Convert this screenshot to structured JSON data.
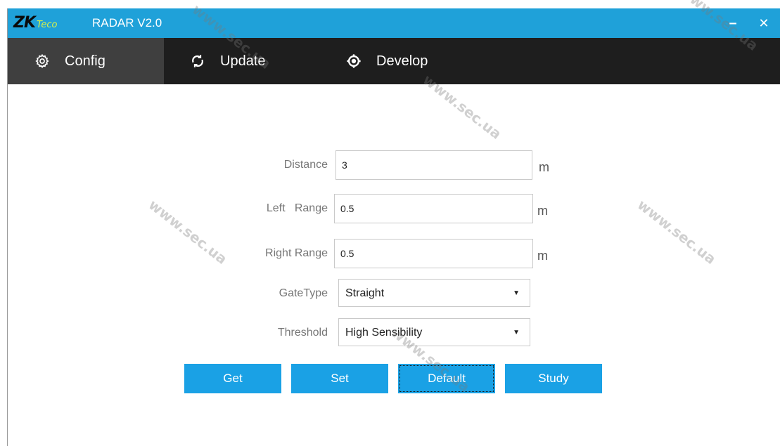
{
  "app": {
    "logo_zk": "ZK",
    "logo_teco": "Teco",
    "title": "RADAR V2.0",
    "minimize_glyph": "–",
    "close_glyph": "✕"
  },
  "nav": {
    "items": [
      {
        "label": "Config",
        "icon": "gear-icon",
        "active": true
      },
      {
        "label": "Update",
        "icon": "refresh-icon",
        "active": false
      },
      {
        "label": "Develop",
        "icon": "develop-icon",
        "active": false
      }
    ]
  },
  "form": {
    "distance": {
      "label": "Distance",
      "value": "3",
      "unit": "m"
    },
    "left_range": {
      "label": "Left   Range",
      "value": "0.5",
      "unit": "m"
    },
    "right_range": {
      "label": "Right Range",
      "value": "0.5",
      "unit": "m"
    },
    "gate_type": {
      "label": "GateType",
      "selected": "Straight"
    },
    "threshold": {
      "label": "Threshold",
      "selected": "High Sensibility"
    }
  },
  "buttons": {
    "get": "Get",
    "set": "Set",
    "default": "Default",
    "study": "Study"
  },
  "watermark": "www.sec.ua",
  "colors": {
    "titlebar": "#1fa1d9",
    "navbar": "#1e1e1e",
    "nav_active": "#3f3f3f",
    "button": "#1aa1e5"
  }
}
